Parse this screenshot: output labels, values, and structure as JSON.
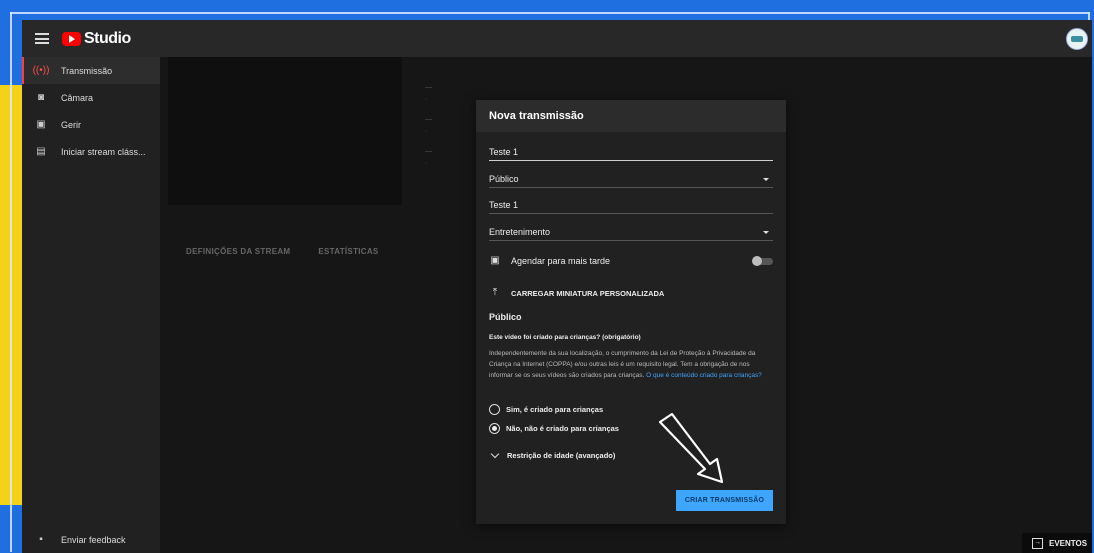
{
  "app": {
    "logo_text": "Studio"
  },
  "sidebar": {
    "items": [
      {
        "label": "Transmissão",
        "icon": "live-icon"
      },
      {
        "label": "Câmara",
        "icon": "camera-icon"
      },
      {
        "label": "Gerir",
        "icon": "calendar-icon"
      },
      {
        "label": "Iniciar stream cláss...",
        "icon": "device-icon"
      }
    ],
    "feedback_label": "Enviar feedback"
  },
  "content": {
    "tabs": [
      "DEFINIÇÕES DA STREAM",
      "ESTATÍSTICAS"
    ],
    "events_label": "EVENTOS"
  },
  "modal": {
    "title": "Nova transmissão",
    "title_value": "Teste 1",
    "privacy_value": "Público",
    "description_value": "Teste 1",
    "category_value": "Entretenimento",
    "schedule_label": "Agendar para mais tarde",
    "schedule_on": false,
    "upload_label": "CARREGAR MINIATURA PERSONALIZADA",
    "section_title": "Público",
    "question": "Este vídeo foi criado para crianças? (obrigatório)",
    "desc_text": "Independentemente da sua localização, o cumprimento da Lei de Proteção à Privacidade da Criança na Internet (COPPA) e/ou outras leis é um requisito legal. Tem a obrigação de nos informar se os seus vídeos são criados para crianças.",
    "desc_link": "O que é conteúdo criado para crianças?",
    "radio_yes": "Sim, é criado para crianças",
    "radio_no": "Não, não é criado para crianças",
    "advanced_label": "Restrição de idade (avançado)",
    "create_button": "CRIAR TRANSMISSÃO"
  },
  "colors": {
    "accent": "#3ea6ff",
    "live_red": "#ff4e45",
    "frame_blue": "#1f6fe0",
    "frame_yellow": "#f4d21a"
  }
}
